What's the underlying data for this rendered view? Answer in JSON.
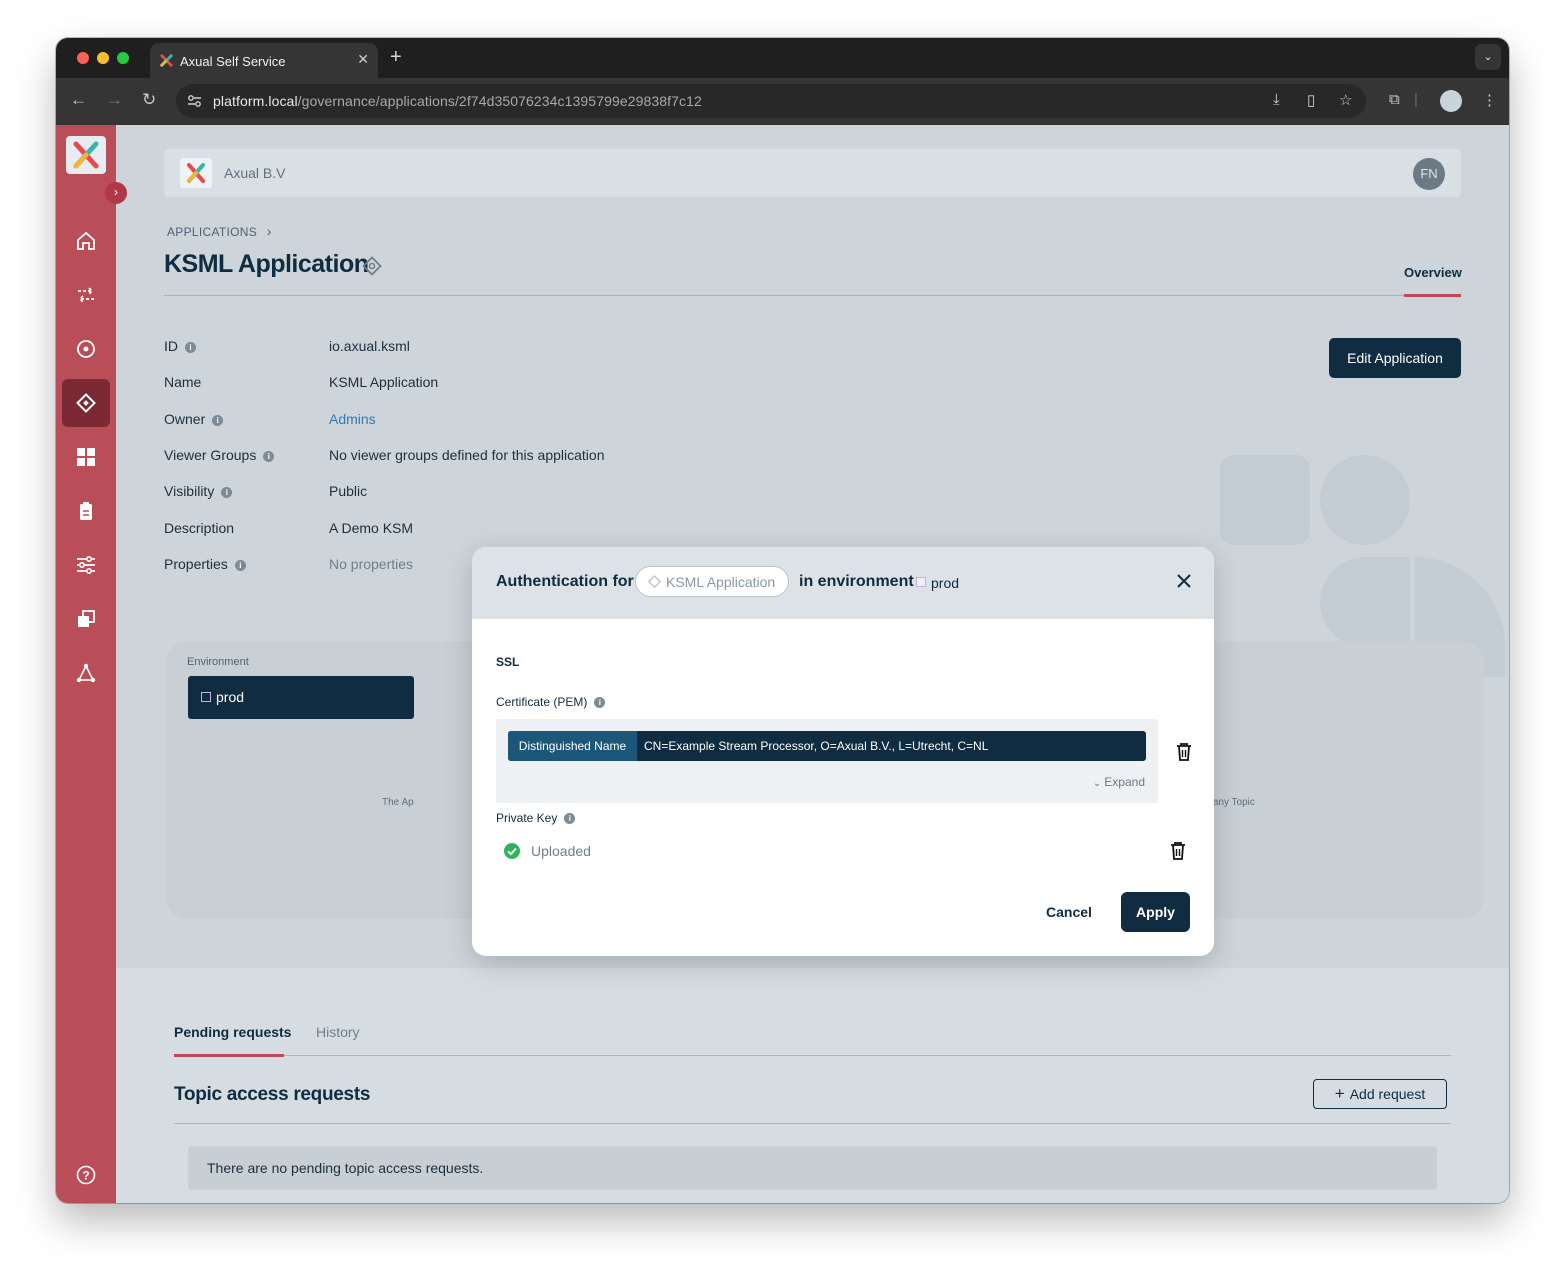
{
  "browser": {
    "tab_title": "Axual Self Service",
    "tab_close": "✕",
    "new_tab": "+",
    "url_host": "platform.local",
    "url_path": "/governance/applications/2f74d35076234c1395799e29838f7c12"
  },
  "header": {
    "org_name": "Axual B.V",
    "avatar_initials": "FN"
  },
  "breadcrumb": {
    "item": "APPLICATIONS",
    "separator": "›"
  },
  "page": {
    "title": "KSML Application",
    "overview_tab": "Overview",
    "edit_button": "Edit Application"
  },
  "details": [
    {
      "label": "ID",
      "value": "io.axual.ksml",
      "info": true
    },
    {
      "label": "Name",
      "value": "KSML Application",
      "info": false
    },
    {
      "label": "Owner",
      "value": "Admins",
      "info": true
    },
    {
      "label": "Viewer Groups",
      "value": "No viewer groups defined for this application",
      "info": true
    },
    {
      "label": "Visibility",
      "value": "Public",
      "info": true
    },
    {
      "label": "Description",
      "value": "A Demo KSM",
      "info": false
    },
    {
      "label": "Properties",
      "value": "No properties",
      "info": true
    }
  ],
  "environment_card": {
    "label": "Environment",
    "selected": "prod",
    "note_left": "The Ap",
    "note_right": "producing to any Topic"
  },
  "lower": {
    "tab_pending": "Pending requests",
    "tab_history": "History",
    "section_title": "Topic access requests",
    "add_request": "Add request",
    "empty_message": "There are no pending topic access requests."
  },
  "modal": {
    "title_prefix": "Authentication for",
    "app_chip": "KSML Application",
    "title_middle": "in environment",
    "environment": "prod",
    "section": "SSL",
    "certificate_label": "Certificate (PEM)",
    "dn_tag": "Distinguished Name",
    "dn_value": "CN=Example Stream Processor, O=Axual B.V., L=Utrecht, C=NL",
    "expand": "Expand",
    "private_key_label": "Private Key",
    "private_key_status": "Uploaded",
    "cancel": "Cancel",
    "apply": "Apply"
  },
  "colors": {
    "sidebar": "#b94d58",
    "primary": "#0f2c40",
    "accent_underline": "#c0485a",
    "success": "#2fb35a",
    "link": "#2f7ab7"
  }
}
